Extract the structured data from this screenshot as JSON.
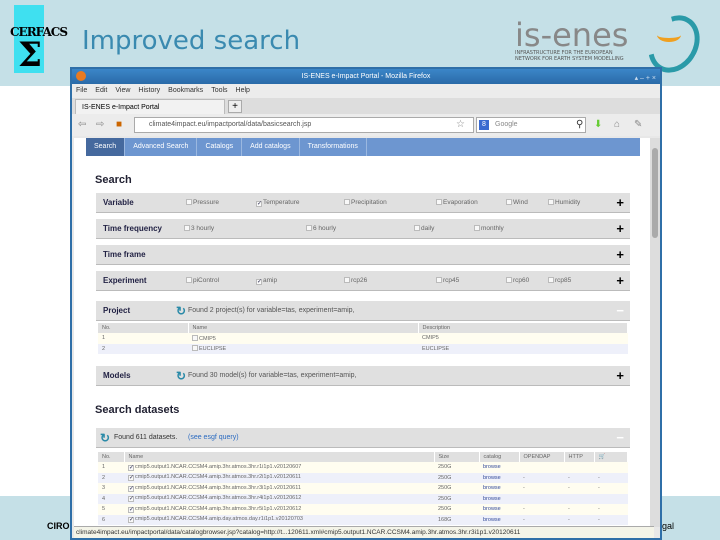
{
  "slide": {
    "title": "Improved search",
    "logo_left": "CERFACS",
    "logo_right": "is-enes",
    "logo_right_sub": "INFRASTRUCTURE FOR THE EUROPEAN NETWORK FOR EARTH SYSTEM MODELLING",
    "footer_left": "CIRO",
    "footer_right": "gal"
  },
  "browser": {
    "window_title": "IS-ENES    e-Impact Portal - Mozilla Firefox",
    "menu": [
      "File",
      "Edit",
      "View",
      "History",
      "Bookmarks",
      "Tools",
      "Help"
    ],
    "tab_label": "IS-ENES    e-Impact Portal",
    "new_tab": "+",
    "url": "climate4impact.eu/impactportal/data/basicsearch.jsp",
    "search_placeholder": "Google",
    "status_url": "climate4impact.eu/impactportal/data/catalogbrowser.jsp?catalog=http://t...120611.xml#cmip5.output1.NCAR.CCSM4.amip.3hr.atmos.3hr.r3i1p1.v20120611"
  },
  "page": {
    "tabs": [
      "Search",
      "Advanced Search",
      "Catalogs",
      "Add catalogs",
      "Transformations"
    ],
    "search_heading": "Search",
    "facets": [
      {
        "label": "Variable",
        "options": [
          {
            "t": "Pressure",
            "c": false
          },
          {
            "t": "Temperature",
            "c": true
          },
          {
            "t": "Precipitation",
            "c": false
          },
          {
            "t": "Evaporation",
            "c": false
          },
          {
            "t": "Wind",
            "c": false
          },
          {
            "t": "Humidity",
            "c": false
          }
        ]
      },
      {
        "label": "Time frequency",
        "options": [
          {
            "t": "3 hourly",
            "c": false
          },
          {
            "t": "6 hourly",
            "c": false
          },
          {
            "t": "daily",
            "c": false
          },
          {
            "t": "monthly",
            "c": false
          }
        ]
      },
      {
        "label": "Time frame",
        "options": []
      },
      {
        "label": "Experiment",
        "options": [
          {
            "t": "piControl",
            "c": false
          },
          {
            "t": "amip",
            "c": true
          },
          {
            "t": "rcp26",
            "c": false
          },
          {
            "t": "rcp45",
            "c": false
          },
          {
            "t": "rcp60",
            "c": false
          },
          {
            "t": "rcp85",
            "c": false
          }
        ]
      }
    ],
    "project": {
      "label": "Project",
      "message": "Found 2 project(s) for variable=tas, experiment=amip,",
      "columns": [
        "No.",
        "Name",
        "Description"
      ],
      "rows": [
        [
          "1",
          "CMIP5",
          "CMIP5"
        ],
        [
          "2",
          "EUCLIPSE",
          "EUCLIPSE"
        ]
      ]
    },
    "models": {
      "label": "Models",
      "message": "Found 30 model(s) for variable=tas, experiment=amip,"
    },
    "datasets_heading": "Search datasets",
    "datasets": {
      "message": "Found 611 datasets.",
      "query_link": "(see esgf query)",
      "columns": [
        "No.",
        "Name",
        "Size",
        "catalog",
        "OPENDAP",
        "HTTP",
        "cart"
      ],
      "rows": [
        [
          "1",
          "cmip5.output1.NCAR.CCSM4.amip.3hr.atmos.3hr.r1i1p1.v20120607",
          "250G",
          "browse",
          "",
          "",
          ""
        ],
        [
          "2",
          "cmip5.output1.NCAR.CCSM4.amip.3hr.atmos.3hr.r2i1p1.v20120611",
          "250G",
          "browse",
          "-",
          "-",
          "-"
        ],
        [
          "3",
          "cmip5.output1.NCAR.CCSM4.amip.3hr.atmos.3hr.r3i1p1.v20120611",
          "250G",
          "browse",
          "-",
          "-",
          "-"
        ],
        [
          "4",
          "cmip5.output1.NCAR.CCSM4.amip.3hr.atmos.3hr.r4i1p1.v20120612",
          "250G",
          "browse",
          "",
          "",
          ""
        ],
        [
          "5",
          "cmip5.output1.NCAR.CCSM4.amip.3hr.atmos.3hr.r5i1p1.v20120612",
          "250G",
          "browse",
          "-",
          "-",
          "-"
        ],
        [
          "6",
          "cmip5.output1.NCAR.CCSM4.amip.day.atmos.day.r1i1p1.v20120703",
          "168G",
          "browse",
          "-",
          "-",
          "-"
        ]
      ]
    }
  }
}
